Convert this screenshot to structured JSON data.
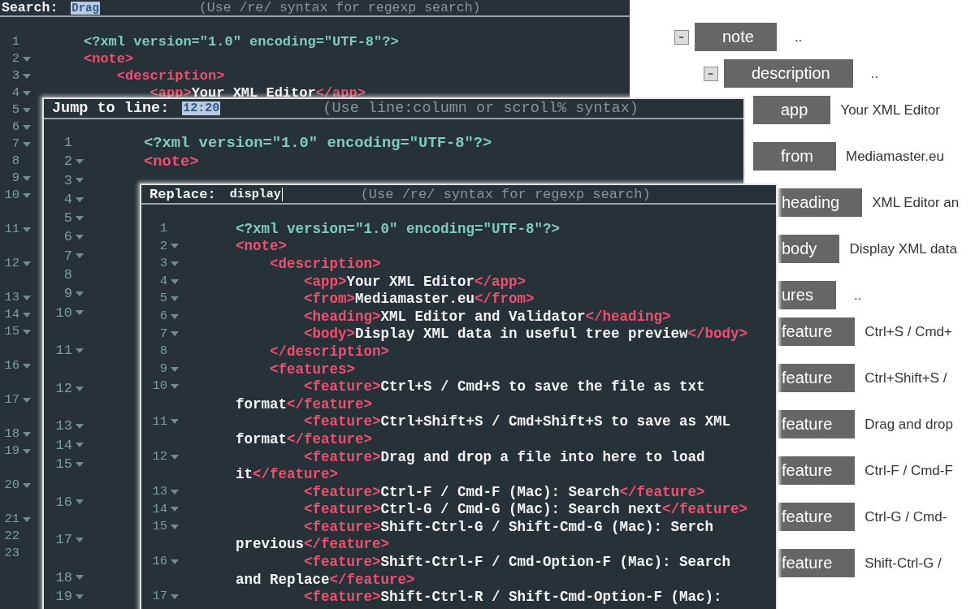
{
  "editors": [
    {
      "prompt": {
        "label": "Search:",
        "value": "Drag",
        "selected": true,
        "hint": "(Use /re/ syntax for regexp search)"
      },
      "lines": [
        {
          "number": "1",
          "foldable": false,
          "wrapped": false,
          "code": [
            {
              "kind": "decl",
              "text": "<?xml version=\"1.0\" encoding=\"UTF-8\"?>"
            }
          ]
        },
        {
          "number": "2",
          "foldable": true,
          "wrapped": false,
          "code": [
            {
              "kind": "tag",
              "text": "<note>"
            }
          ]
        },
        {
          "number": "3",
          "foldable": true,
          "wrapped": false,
          "code": [
            {
              "kind": "tag",
              "text": "    <description>"
            }
          ]
        },
        {
          "number": "4",
          "foldable": true,
          "wrapped": false,
          "code": [
            {
              "kind": "tag",
              "text": "        <app>"
            },
            {
              "kind": "text",
              "text": "Your XML Editor"
            },
            {
              "kind": "tag",
              "text": "</app>"
            }
          ]
        },
        {
          "number": "5",
          "foldable": true,
          "wrapped": false
        },
        {
          "number": "6",
          "foldable": true,
          "wrapped": false
        },
        {
          "number": "7",
          "foldable": true,
          "wrapped": false
        },
        {
          "number": "8",
          "foldable": false,
          "wrapped": false
        },
        {
          "number": "9",
          "foldable": true,
          "wrapped": false
        },
        {
          "number": "10",
          "foldable": true,
          "wrapped": true
        },
        {
          "number": "11",
          "foldable": true,
          "wrapped": true
        },
        {
          "number": "12",
          "foldable": true,
          "wrapped": true
        },
        {
          "number": "13",
          "foldable": true,
          "wrapped": false
        },
        {
          "number": "14",
          "foldable": true,
          "wrapped": false
        },
        {
          "number": "15",
          "foldable": true,
          "wrapped": true
        },
        {
          "number": "16",
          "foldable": true,
          "wrapped": true
        },
        {
          "number": "17",
          "foldable": true,
          "wrapped": true
        },
        {
          "number": "18",
          "foldable": true,
          "wrapped": false
        },
        {
          "number": "19",
          "foldable": true,
          "wrapped": true
        },
        {
          "number": "20",
          "foldable": true,
          "wrapped": true
        },
        {
          "number": "21",
          "foldable": true,
          "wrapped": false
        },
        {
          "number": "22",
          "foldable": false,
          "wrapped": false
        },
        {
          "number": "23",
          "foldable": false,
          "wrapped": false
        }
      ]
    },
    {
      "prompt": {
        "label": "Jump to line:",
        "value": "12:20",
        "selected": true,
        "hint": "(Use line:column or scroll% syntax)"
      },
      "lines": [
        {
          "number": "1",
          "foldable": false,
          "wrapped": false,
          "code": [
            {
              "kind": "decl",
              "text": "<?xml version=\"1.0\" encoding=\"UTF-8\"?>"
            }
          ]
        },
        {
          "number": "2",
          "foldable": true,
          "wrapped": false,
          "code": [
            {
              "kind": "tag",
              "text": "<note>"
            }
          ]
        },
        {
          "number": "3",
          "foldable": true,
          "wrapped": false
        },
        {
          "number": "4",
          "foldable": true,
          "wrapped": false
        },
        {
          "number": "5",
          "foldable": true,
          "wrapped": false
        },
        {
          "number": "6",
          "foldable": true,
          "wrapped": false
        },
        {
          "number": "7",
          "foldable": true,
          "wrapped": false
        },
        {
          "number": "8",
          "foldable": false,
          "wrapped": false
        },
        {
          "number": "9",
          "foldable": true,
          "wrapped": false
        },
        {
          "number": "10",
          "foldable": true,
          "wrapped": true
        },
        {
          "number": "11",
          "foldable": true,
          "wrapped": true
        },
        {
          "number": "12",
          "foldable": true,
          "wrapped": true
        },
        {
          "number": "13",
          "foldable": true,
          "wrapped": false
        },
        {
          "number": "14",
          "foldable": true,
          "wrapped": false
        },
        {
          "number": "15",
          "foldable": true,
          "wrapped": true
        },
        {
          "number": "16",
          "foldable": true,
          "wrapped": true
        },
        {
          "number": "17",
          "foldable": true,
          "wrapped": true
        },
        {
          "number": "18",
          "foldable": true,
          "wrapped": false
        },
        {
          "number": "19",
          "foldable": true,
          "wrapped": false
        }
      ]
    },
    {
      "prompt": {
        "label": "Replace:",
        "value": "display",
        "selected": false,
        "hint": "(Use /re/ syntax for regexp search)"
      },
      "lines": [
        {
          "number": "1",
          "foldable": false,
          "wrapped": false,
          "code": [
            {
              "kind": "decl",
              "text": "<?xml version=\"1.0\" encoding=\"UTF-8\"?>"
            }
          ]
        },
        {
          "number": "2",
          "foldable": true,
          "wrapped": false,
          "code": [
            {
              "kind": "tag",
              "text": "<note>"
            }
          ]
        },
        {
          "number": "3",
          "foldable": true,
          "wrapped": false,
          "code": [
            {
              "kind": "tag",
              "text": "    <description>"
            }
          ]
        },
        {
          "number": "4",
          "foldable": true,
          "wrapped": false,
          "code": [
            {
              "kind": "tag",
              "text": "        <app>"
            },
            {
              "kind": "text",
              "text": "Your XML Editor"
            },
            {
              "kind": "tag",
              "text": "</app>"
            }
          ]
        },
        {
          "number": "5",
          "foldable": true,
          "wrapped": false,
          "code": [
            {
              "kind": "tag",
              "text": "        <from>"
            },
            {
              "kind": "text",
              "text": "Mediamaster.eu"
            },
            {
              "kind": "tag",
              "text": "</from>"
            }
          ]
        },
        {
          "number": "6",
          "foldable": true,
          "wrapped": false,
          "code": [
            {
              "kind": "tag",
              "text": "        <heading>"
            },
            {
              "kind": "text",
              "text": "XML Editor and Validator"
            },
            {
              "kind": "tag",
              "text": "</heading>"
            }
          ]
        },
        {
          "number": "7",
          "foldable": true,
          "wrapped": false,
          "code": [
            {
              "kind": "tag",
              "text": "        <body>"
            },
            {
              "kind": "text",
              "text": "Display XML data in useful tree preview"
            },
            {
              "kind": "tag",
              "text": "</body>"
            }
          ]
        },
        {
          "number": "8",
          "foldable": false,
          "wrapped": false,
          "code": [
            {
              "kind": "tag",
              "text": "    </description>"
            }
          ]
        },
        {
          "number": "9",
          "foldable": true,
          "wrapped": false,
          "code": [
            {
              "kind": "tag",
              "text": "    <features>"
            }
          ]
        },
        {
          "number": "10",
          "foldable": true,
          "wrapped": true,
          "code": [
            {
              "kind": "tag",
              "text": "        <feature>"
            },
            {
              "kind": "text",
              "text": "Ctrl+S / Cmd+S to save the file as txt"
            }
          ],
          "continuation": [
            {
              "kind": "text",
              "text": "format"
            },
            {
              "kind": "tag",
              "text": "</feature>"
            }
          ]
        },
        {
          "number": "11",
          "foldable": true,
          "wrapped": true,
          "code": [
            {
              "kind": "tag",
              "text": "        <feature>"
            },
            {
              "kind": "text",
              "text": "Ctrl+Shift+S / Cmd+Shift+S to save as XML"
            }
          ],
          "continuation": [
            {
              "kind": "text",
              "text": "format"
            },
            {
              "kind": "tag",
              "text": "</feature>"
            }
          ]
        },
        {
          "number": "12",
          "foldable": true,
          "wrapped": true,
          "code": [
            {
              "kind": "tag",
              "text": "        <feature>"
            },
            {
              "kind": "text",
              "text": "Drag and drop a file into here to load"
            }
          ],
          "continuation": [
            {
              "kind": "text",
              "text": "it"
            },
            {
              "kind": "tag",
              "text": "</feature>"
            }
          ]
        },
        {
          "number": "13",
          "foldable": true,
          "wrapped": false,
          "code": [
            {
              "kind": "tag",
              "text": "        <feature>"
            },
            {
              "kind": "text",
              "text": "Ctrl-F / Cmd-F (Mac): Search"
            },
            {
              "kind": "tag",
              "text": "</feature>"
            }
          ]
        },
        {
          "number": "14",
          "foldable": true,
          "wrapped": false,
          "code": [
            {
              "kind": "tag",
              "text": "        <feature>"
            },
            {
              "kind": "text",
              "text": "Ctrl-G / Cmd-G (Mac): Search next"
            },
            {
              "kind": "tag",
              "text": "</feature>"
            }
          ]
        },
        {
          "number": "15",
          "foldable": true,
          "wrapped": true,
          "code": [
            {
              "kind": "tag",
              "text": "        <feature>"
            },
            {
              "kind": "text",
              "text": "Shift-Ctrl-G / Shift-Cmd-G (Mac): Serch"
            }
          ],
          "continuation": [
            {
              "kind": "text",
              "text": "previous"
            },
            {
              "kind": "tag",
              "text": "</feature>"
            }
          ]
        },
        {
          "number": "16",
          "foldable": true,
          "wrapped": true,
          "code": [
            {
              "kind": "tag",
              "text": "        <feature>"
            },
            {
              "kind": "text",
              "text": "Shift-Ctrl-F / Cmd-Option-F (Mac): Search"
            }
          ],
          "continuation": [
            {
              "kind": "text",
              "text": "and Replace"
            },
            {
              "kind": "tag",
              "text": "</feature>"
            }
          ]
        },
        {
          "number": "17",
          "foldable": true,
          "wrapped": true,
          "code": [
            {
              "kind": "tag",
              "text": "        <feature>"
            },
            {
              "kind": "text",
              "text": "Shift-Ctrl-R / Shift-Cmd-Option-F (Mac):"
            }
          ]
        }
      ]
    }
  ],
  "tree": [
    {
      "label": "note",
      "value": "..",
      "expanded": true,
      "clipped": false,
      "children": [
        {
          "label": "description",
          "value": "..",
          "expanded": true,
          "clipped": false,
          "children": [
            {
              "label": "app",
              "value": "Your XML Editor",
              "clipped": false
            },
            {
              "label": "from",
              "value": "Mediamaster.eu",
              "clipped": false
            },
            {
              "label": "heading",
              "value": "XML Editor an",
              "clipped": true
            },
            {
              "label": "body",
              "value": "Display XML data",
              "clipped": true
            }
          ]
        },
        {
          "label": "ures",
          "value": "..",
          "clipped": true,
          "children": [
            {
              "label": "feature",
              "value": "Ctrl+S / Cmd+",
              "clipped": true
            },
            {
              "label": "feature",
              "value": "Ctrl+Shift+S /",
              "clipped": true
            },
            {
              "label": "feature",
              "value": "Drag and drop",
              "clipped": true
            },
            {
              "label": "feature",
              "value": "Ctrl-F / Cmd-F",
              "clipped": true
            },
            {
              "label": "feature",
              "value": "Ctrl-G / Cmd-",
              "clipped": true
            },
            {
              "label": "feature",
              "value": "Shift-Ctrl-G /",
              "clipped": true
            }
          ]
        }
      ]
    }
  ]
}
